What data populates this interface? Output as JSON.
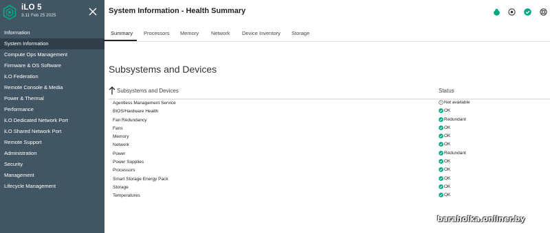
{
  "sidebar": {
    "brand_title": "iLO 5",
    "brand_version": "3.11 Feb 25 2025",
    "items": [
      {
        "label": "Information",
        "active": false
      },
      {
        "label": "System Information",
        "active": true
      },
      {
        "label": "Compute Ops Management",
        "active": false
      },
      {
        "label": "Firmware & OS Software",
        "active": false
      },
      {
        "label": "iLO Federation",
        "active": false
      },
      {
        "label": "Remote Console & Media",
        "active": false
      },
      {
        "label": "Power & Thermal",
        "active": false
      },
      {
        "label": "Performance",
        "active": false
      },
      {
        "label": "iLO Dedicated Network Port",
        "active": false
      },
      {
        "label": "iLO Shared Network Port",
        "active": false
      },
      {
        "label": "Remote Support",
        "active": false
      },
      {
        "label": "Administration",
        "active": false
      },
      {
        "label": "Security",
        "active": false
      },
      {
        "label": "Management",
        "active": false
      },
      {
        "label": "Lifecycle Management",
        "active": false
      }
    ]
  },
  "header": {
    "title": "System Information - Health Summary",
    "icons": [
      "health-icon",
      "uid-icon",
      "status-ok-icon",
      "help-icon"
    ]
  },
  "tabs": [
    {
      "label": "Summary",
      "active": true
    },
    {
      "label": "Processors",
      "active": false
    },
    {
      "label": "Memory",
      "active": false
    },
    {
      "label": "Network",
      "active": false
    },
    {
      "label": "Device Inventory",
      "active": false
    },
    {
      "label": "Storage",
      "active": false
    }
  ],
  "main": {
    "section_title": "Subsystems and Devices",
    "columns": {
      "name": "Subsystems and Devices",
      "status": "Status"
    },
    "rows": [
      {
        "name": "Agentless Management Service",
        "status": "Not available",
        "state": "unknown"
      },
      {
        "name": "BIOS/Hardware Health",
        "status": "OK",
        "state": "ok"
      },
      {
        "name": "Fan Redundancy",
        "status": "Redundant",
        "state": "ok"
      },
      {
        "name": "Fans",
        "status": "OK",
        "state": "ok"
      },
      {
        "name": "Memory",
        "status": "OK",
        "state": "ok"
      },
      {
        "name": "Network",
        "status": "OK",
        "state": "ok"
      },
      {
        "name": "Power",
        "status": "Redundant",
        "state": "ok"
      },
      {
        "name": "Power Supplies",
        "status": "OK",
        "state": "ok"
      },
      {
        "name": "Processors",
        "status": "OK",
        "state": "ok"
      },
      {
        "name": "Smart Storage Energy Pack",
        "status": "OK",
        "state": "ok"
      },
      {
        "name": "Storage",
        "status": "OK",
        "state": "ok"
      },
      {
        "name": "Temperatures",
        "status": "OK",
        "state": "ok"
      }
    ]
  },
  "watermark": "baraholka.onliner.by",
  "colors": {
    "sidebar_bg": "#425563",
    "sidebar_active": "#2f3e49",
    "accent_green": "#01a982"
  }
}
